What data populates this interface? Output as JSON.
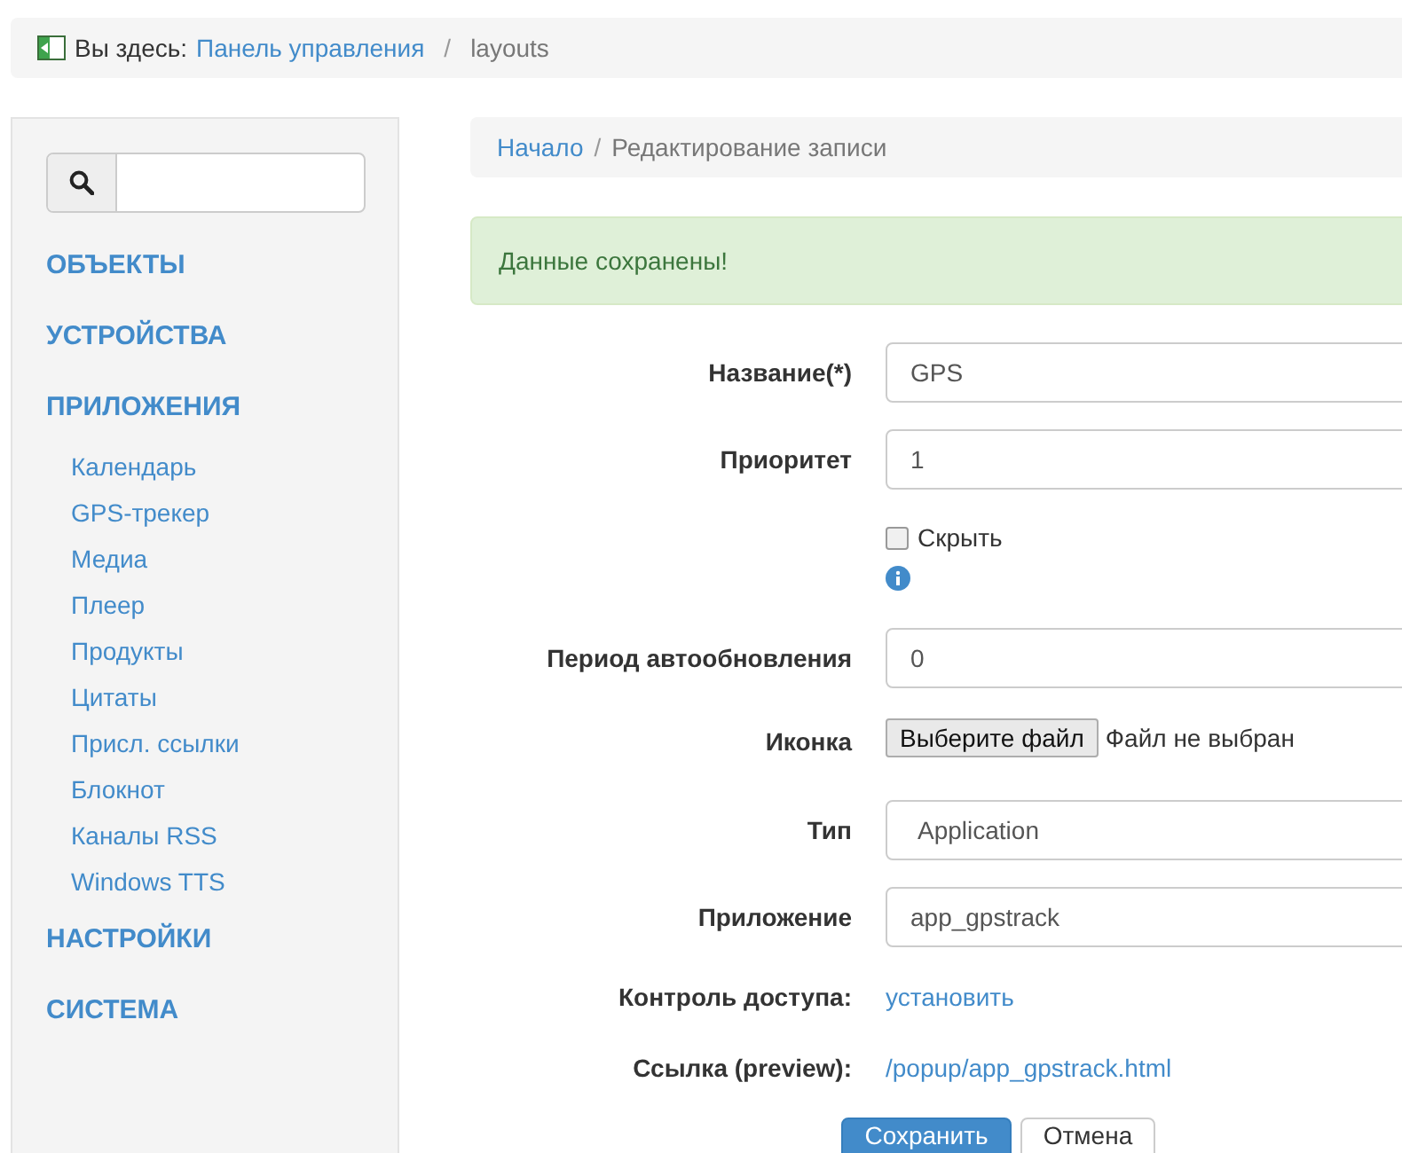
{
  "top_breadcrumb": {
    "prefix": "Вы здесь:",
    "items": [
      {
        "label": "Панель управления",
        "kind": "link"
      },
      {
        "label": "/",
        "kind": "separator"
      },
      {
        "label": "layouts",
        "kind": "current"
      }
    ]
  },
  "sidebar": {
    "items": [
      {
        "label": "ОБЪЕКТЫ"
      },
      {
        "label": "УСТРОЙСТВА"
      },
      {
        "label": "ПРИЛОЖЕНИЯ",
        "children": [
          {
            "label": "Календарь"
          },
          {
            "label": "GPS-трекер"
          },
          {
            "label": "Медиа"
          },
          {
            "label": "Плеер"
          },
          {
            "label": "Продукты"
          },
          {
            "label": "Цитаты"
          },
          {
            "label": "Присл. ссылки"
          },
          {
            "label": "Блокнот"
          },
          {
            "label": "Каналы RSS"
          },
          {
            "label": "Windows TTS"
          }
        ]
      },
      {
        "label": "НАСТРОЙКИ"
      },
      {
        "label": "СИСТЕМА"
      }
    ]
  },
  "breadcrumb": [
    {
      "label": "Начало",
      "kind": "link"
    },
    {
      "label": "/",
      "kind": "separator"
    },
    {
      "label": "Редактирование записи",
      "kind": "current"
    }
  ],
  "alert": "Данные сохранены!",
  "form": {
    "fields": [
      {
        "kind": "text",
        "label": "Название(*)",
        "value": "GPS"
      },
      {
        "kind": "text",
        "label": "Приоритет",
        "value": "1"
      },
      {
        "kind": "checkbox",
        "label": "Скрыть",
        "checked": false
      },
      {
        "kind": "text",
        "label": "Период автообновления",
        "value": "0"
      },
      {
        "kind": "file",
        "label": "Иконка",
        "button": "Выберите файл",
        "status": "Файл не выбран"
      },
      {
        "kind": "select",
        "label": "Тип",
        "value": "Application"
      },
      {
        "kind": "text",
        "label": "Приложение",
        "value": "app_gpstrack"
      },
      {
        "kind": "link",
        "label": "Контроль доступа:",
        "value": "установить"
      },
      {
        "kind": "link",
        "label": "Ссылка (preview):",
        "value": "/popup/app_gpstrack.html"
      }
    ],
    "buttons": [
      {
        "label": "Сохранить",
        "kind": "primary"
      },
      {
        "label": "Отмена",
        "kind": "default"
      }
    ]
  }
}
